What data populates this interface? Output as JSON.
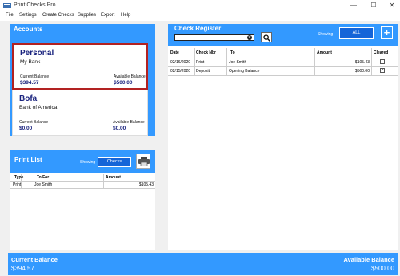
{
  "window": {
    "title": "Print Checks Pro",
    "minimize_glyph": "—",
    "maximize_glyph": "☐",
    "close_glyph": "✕"
  },
  "menu": [
    "File",
    "Settings",
    "Create Checks",
    "Supplies",
    "Export",
    "Help"
  ],
  "accounts_panel": {
    "title": "Accounts",
    "accounts": [
      {
        "name": "Personal",
        "bank": "My Bank",
        "current_label": "Current Balance",
        "current": "$394.57",
        "available_label": "Available Balance",
        "available": "$500.00"
      },
      {
        "name": "Bofa",
        "bank": "Bank of America",
        "current_label": "Current Balance",
        "current": "$0.00",
        "available_label": "Available Balance",
        "available": "$0.00"
      }
    ]
  },
  "print_list": {
    "title": "Print List",
    "showing_label": "Showing",
    "filter": "Checks",
    "printer_icon": "printer-icon",
    "columns": [
      "Type",
      "To/For",
      "Amount"
    ],
    "rows": [
      {
        "type": "Print",
        "to": "Joe Smith",
        "amount": "$105.43"
      }
    ]
  },
  "register": {
    "title": "Check Register",
    "search_placeholder": "",
    "search_icon": "search-icon",
    "clear_icon": "clear-icon",
    "showing_label": "Showing",
    "filter": "ALL",
    "add_label": "+",
    "columns": [
      "Date",
      "Check Nbr",
      "To",
      "Amount",
      "Cleared"
    ],
    "rows": [
      {
        "date": "02/16/2020",
        "check": "Print",
        "to": "Joe Smith",
        "amount": "-$105.43",
        "cleared": false
      },
      {
        "date": "02/15/2020",
        "check": "Deposit",
        "to": "Opening Balance",
        "amount": "$500.00",
        "cleared": true
      }
    ]
  },
  "footer": {
    "current_label": "Current Balance",
    "current": "$394.57",
    "available_label": "Available Balance",
    "available": "$500.00"
  },
  "colors": {
    "accent": "#3399ff",
    "pill": "#1565d8",
    "account_name": "#1a237e",
    "selected_border": "#b22222"
  }
}
